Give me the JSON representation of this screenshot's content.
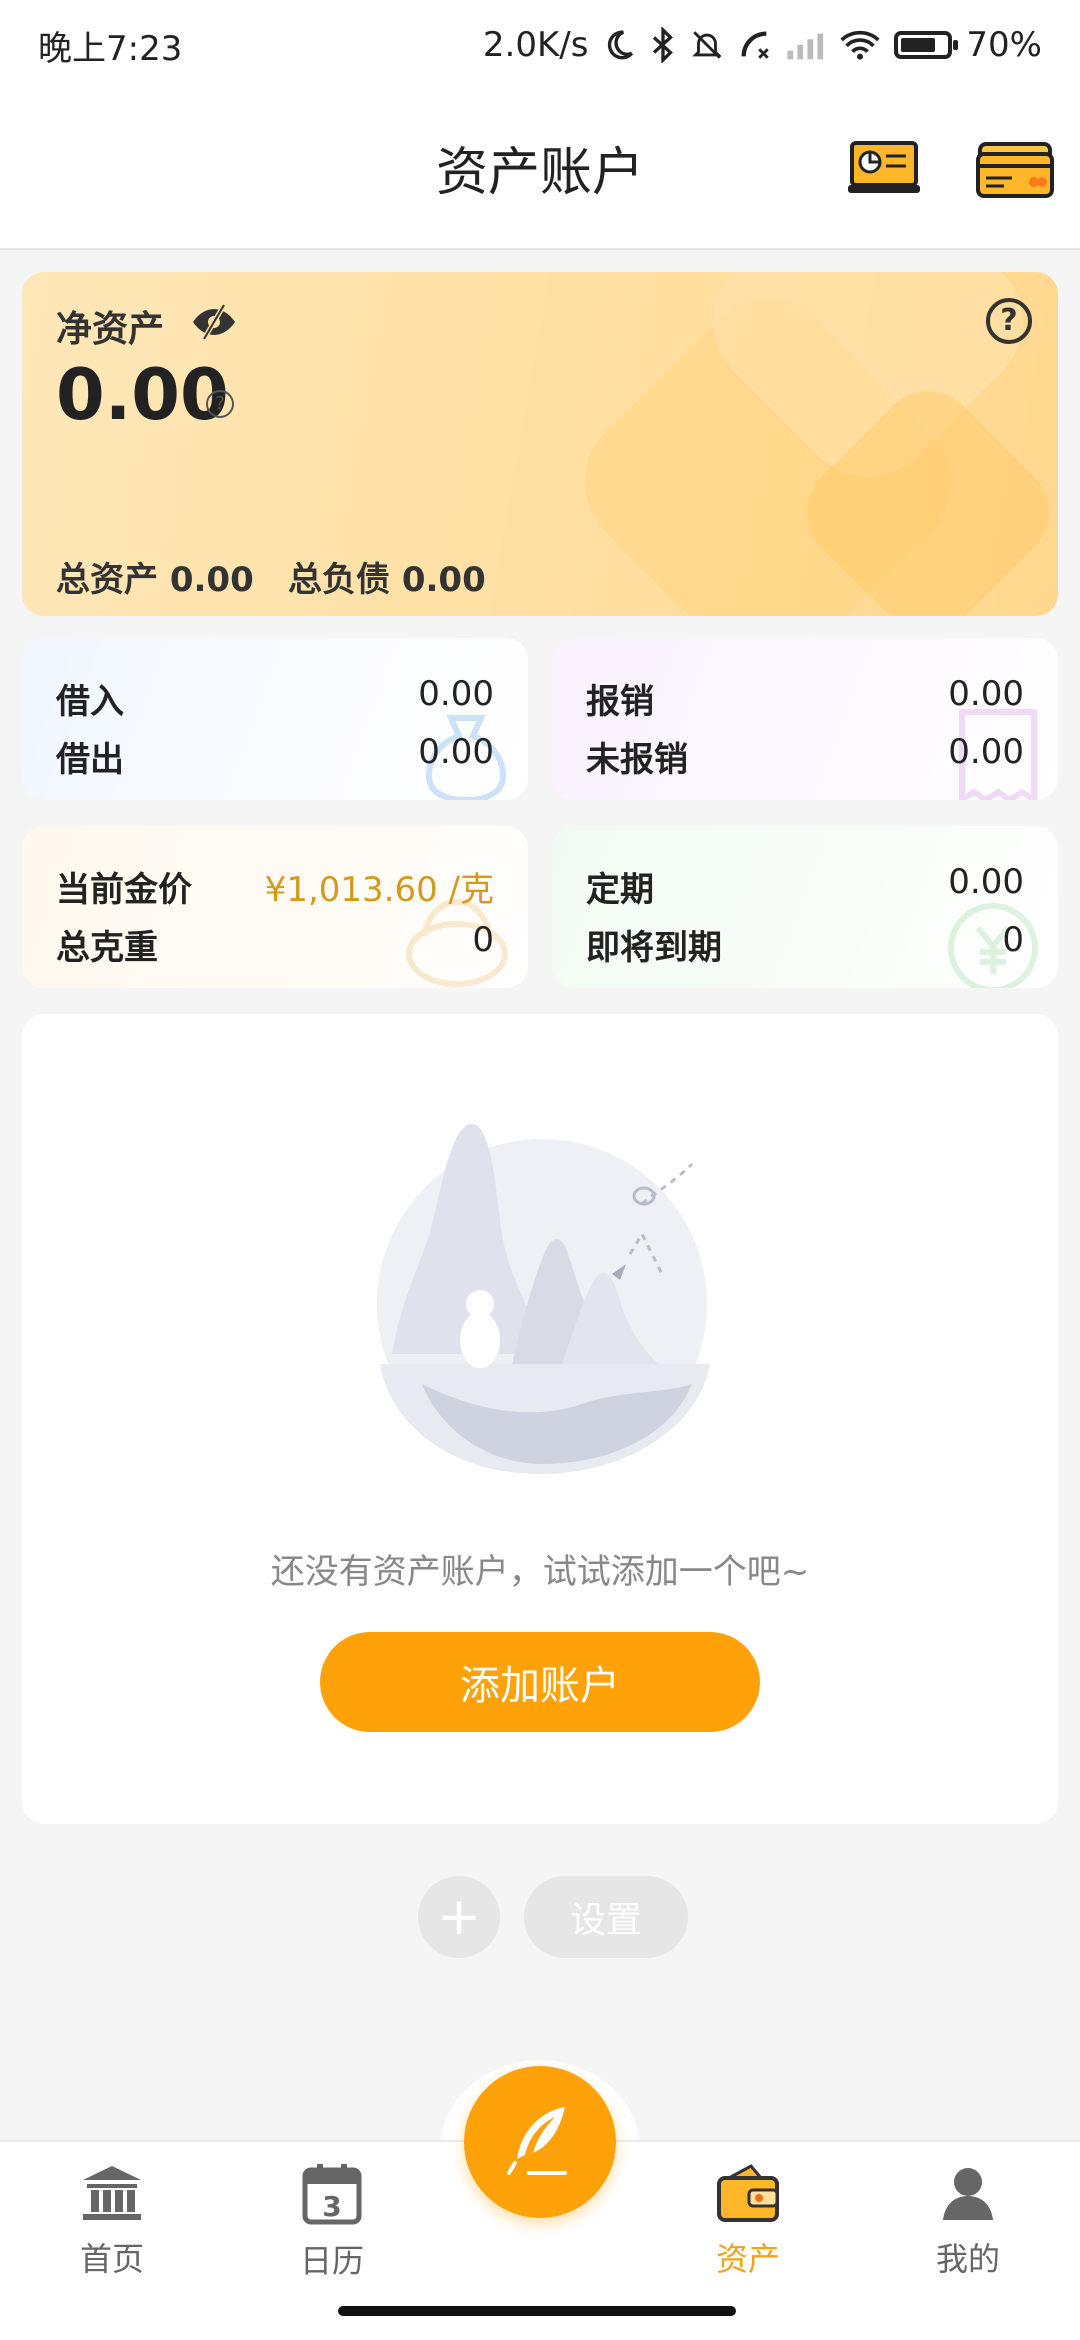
{
  "status_bar": {
    "time": "晚上7:23",
    "speed": "2.0K/s",
    "battery": "70%"
  },
  "header": {
    "title": "资产账户"
  },
  "net_asset": {
    "label": "净资产",
    "value": "0.00",
    "total_assets_label": "总资产",
    "total_assets": "0.00",
    "total_debt_label": "总负债",
    "total_debt": "0.00"
  },
  "cards": {
    "loan": {
      "borrow_in_label": "借入",
      "borrow_in": "0.00",
      "lend_out_label": "借出",
      "lend_out": "0.00"
    },
    "reimburse": {
      "reimbursed_label": "报销",
      "reimbursed": "0.00",
      "unreimbursed_label": "未报销",
      "unreimbursed": "0.00"
    },
    "gold": {
      "price_label": "当前金价",
      "price": "¥1,013.60 /克",
      "weight_label": "总克重",
      "weight": "0"
    },
    "fixed": {
      "fixed_label": "定期",
      "fixed": "0.00",
      "expiring_label": "即将到期",
      "expiring": "0"
    }
  },
  "empty_state": {
    "message": "还没有资产账户，试试添加一个吧~",
    "button": "添加账户"
  },
  "actions": {
    "plus": "+",
    "settings": "设置"
  },
  "nav": {
    "items": [
      {
        "label": "首页",
        "icon": "bank-icon"
      },
      {
        "label": "日历",
        "icon": "calendar-icon"
      },
      {
        "label": "资产",
        "icon": "wallet-icon",
        "active": true
      },
      {
        "label": "我的",
        "icon": "user-icon"
      }
    ],
    "calendar_day": "3"
  },
  "colors": {
    "accent": "#ffa20a",
    "gold_text": "#d49a1c",
    "active_nav": "#f0a318"
  }
}
